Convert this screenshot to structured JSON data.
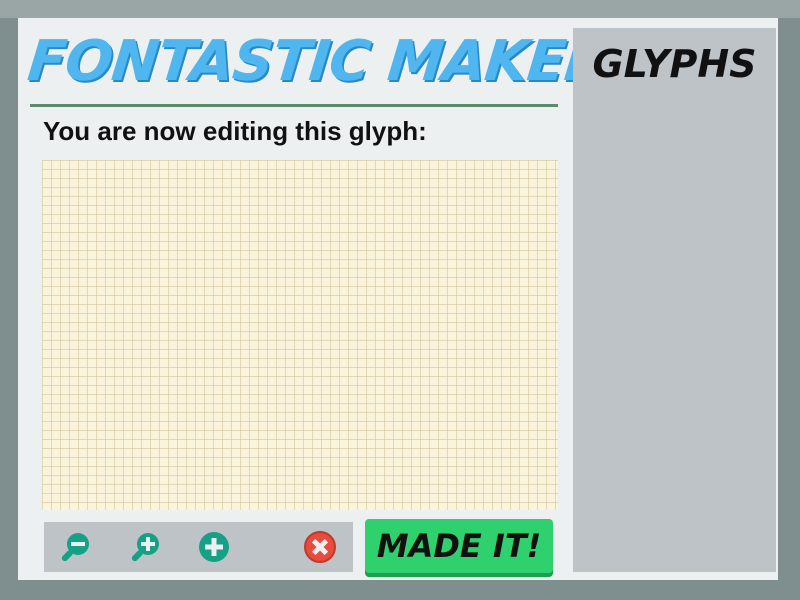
{
  "app": {
    "title": "FONTASTIC MAKER",
    "subtitle": "You are now editing this glyph:"
  },
  "toolbar": {
    "zoom_out_icon": "zoom-out-icon",
    "zoom_in_icon": "zoom-in-icon",
    "add_icon": "plus-circle-icon",
    "clear_icon": "close-circle-icon",
    "tool_color": "#16a085",
    "clear_color": "#e74c3c"
  },
  "actions": {
    "made_it_label": "MADE IT!"
  },
  "sidebar": {
    "title": "GLYPHS"
  },
  "colors": {
    "title": "#4fb6ef",
    "made_button": "#2fd16e",
    "canvas": "#fbf4dc",
    "panel_bg": "#ecf0f1",
    "sidebar_bg": "#bdc3c7"
  }
}
